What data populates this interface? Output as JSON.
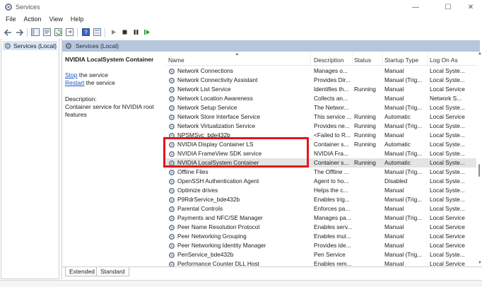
{
  "window": {
    "title": "Services",
    "controls": {
      "minimize": "—",
      "maximize": "☐",
      "close": "✕"
    }
  },
  "menu": [
    "File",
    "Action",
    "View",
    "Help"
  ],
  "toolbar": {
    "icons": [
      "back-arrow-icon",
      "forward-arrow-icon",
      "console-tree-icon",
      "properties-icon",
      "refresh-icon",
      "export-icon",
      "help-icon",
      "details-icon",
      "play-icon",
      "stop-icon",
      "pause-icon",
      "restart-icon"
    ]
  },
  "tree": {
    "root_label": "Services (Local)"
  },
  "panel": {
    "header": "Services (Local)"
  },
  "details": {
    "service_title": "NVIDIA LocalSystem Container",
    "stop_link": "Stop",
    "stop_suffix": " the service",
    "restart_link": "Restart",
    "restart_suffix": " the service",
    "description_label": "Description:",
    "description_text": "Container service for NVIDIA root features"
  },
  "table": {
    "columns": [
      "Name",
      "Description",
      "Status",
      "Startup Type",
      "Log On As"
    ],
    "rows": [
      {
        "name": "Network Connections",
        "desc": "Manages o...",
        "status": "",
        "startup": "Manual",
        "logon": "Local Syste..."
      },
      {
        "name": "Network Connectivity Assistant",
        "desc": "Provides Dir...",
        "status": "",
        "startup": "Manual (Trig...",
        "logon": "Local Syste..."
      },
      {
        "name": "Network List Service",
        "desc": "Identifies th...",
        "status": "Running",
        "startup": "Manual",
        "logon": "Local Service"
      },
      {
        "name": "Network Location Awareness",
        "desc": "Collects an...",
        "status": "",
        "startup": "Manual",
        "logon": "Network S..."
      },
      {
        "name": "Network Setup Service",
        "desc": "The Networ...",
        "status": "",
        "startup": "Manual (Trig...",
        "logon": "Local Syste..."
      },
      {
        "name": "Network Store Interface Service",
        "desc": "This service ...",
        "status": "Running",
        "startup": "Automatic",
        "logon": "Local Service"
      },
      {
        "name": "Network Virtualization Service",
        "desc": "Provides ne...",
        "status": "Running",
        "startup": "Manual (Trig...",
        "logon": "Local Syste..."
      },
      {
        "name": "NPSMSvc_bde432b",
        "desc": "<Failed to R...",
        "status": "Running",
        "startup": "Manual",
        "logon": "Local Syste..."
      },
      {
        "name": "NVIDIA Display Container LS",
        "desc": "Container s...",
        "status": "Running",
        "startup": "Automatic",
        "logon": "Local Syste..."
      },
      {
        "name": "NVIDIA FrameView SDK service",
        "desc": "NVIDIA Fra...",
        "status": "",
        "startup": "Manual (Trig...",
        "logon": "Local Syste..."
      },
      {
        "name": "NVIDIA LocalSystem Container",
        "desc": "Container s...",
        "status": "Running",
        "startup": "Automatic",
        "logon": "Local Syste...",
        "selected": true
      },
      {
        "name": "Offline Files",
        "desc": "The Offline ...",
        "status": "",
        "startup": "Manual (Trig...",
        "logon": "Local Syste..."
      },
      {
        "name": "OpenSSH Authentication Agent",
        "desc": "Agent to ho...",
        "status": "",
        "startup": "Disabled",
        "logon": "Local Syste..."
      },
      {
        "name": "Optimize drives",
        "desc": "Helps the c...",
        "status": "",
        "startup": "Manual",
        "logon": "Local Syste..."
      },
      {
        "name": "P9RdrService_bde432b",
        "desc": "Enables trig...",
        "status": "",
        "startup": "Manual (Trig...",
        "logon": "Local Syste..."
      },
      {
        "name": "Parental Controls",
        "desc": "Enforces pa...",
        "status": "",
        "startup": "Manual",
        "logon": "Local Syste..."
      },
      {
        "name": "Payments and NFC/SE Manager",
        "desc": "Manages pa...",
        "status": "",
        "startup": "Manual (Trig...",
        "logon": "Local Service"
      },
      {
        "name": "Peer Name Resolution Protocol",
        "desc": "Enables serv...",
        "status": "",
        "startup": "Manual",
        "logon": "Local Service"
      },
      {
        "name": "Peer Networking Grouping",
        "desc": "Enables mul...",
        "status": "",
        "startup": "Manual",
        "logon": "Local Service"
      },
      {
        "name": "Peer Networking Identity Manager",
        "desc": "Provides ide...",
        "status": "",
        "startup": "Manual",
        "logon": "Local Service"
      },
      {
        "name": "PenService_bde432b",
        "desc": "Pen Service",
        "status": "",
        "startup": "Manual (Trig...",
        "logon": "Local Syste..."
      },
      {
        "name": "Performance Counter DLL Host",
        "desc": "Enables rem...",
        "status": "",
        "startup": "Manual",
        "logon": "Local Service"
      }
    ]
  },
  "tabs": [
    "Extended",
    "Standard"
  ],
  "colors": {
    "highlight": "#e3161c",
    "link": "#1a55c9",
    "header_band": "#b5c6dd",
    "selected_row": "#e4e4e4"
  }
}
